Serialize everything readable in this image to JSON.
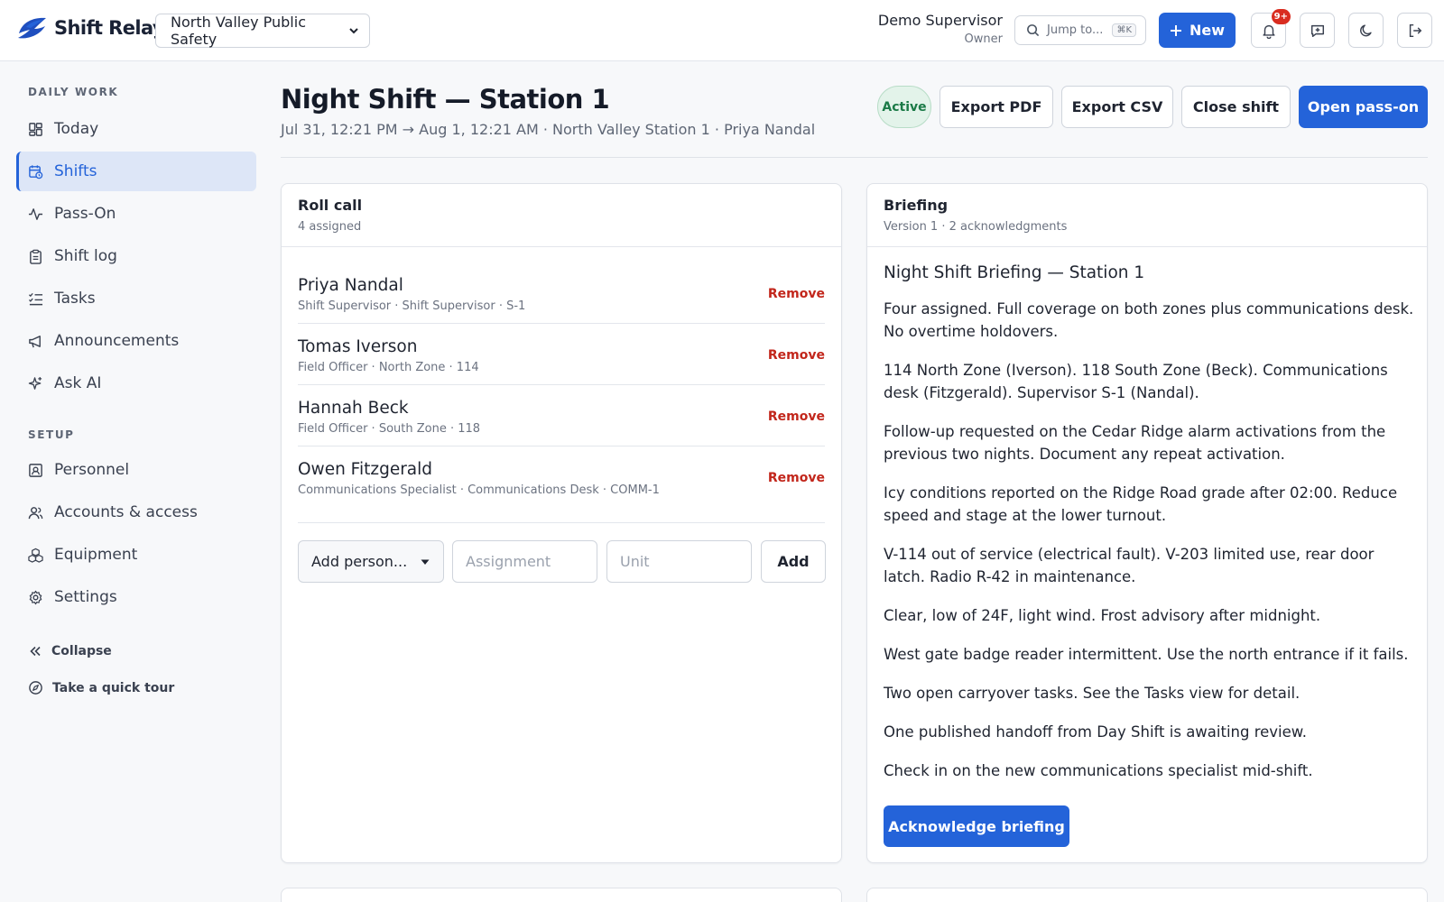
{
  "brand": {
    "name": "Shift Relay",
    "logo_icon": "shift-relay-logo-icon"
  },
  "org_select": {
    "value": "North Valley Public Safety"
  },
  "user": {
    "name": "Demo Supervisor",
    "role": "Owner"
  },
  "jump": {
    "placeholder": "Jump to...",
    "shortcut": "⌘K"
  },
  "new_button": {
    "label": "New"
  },
  "notifications": {
    "badge": "9+"
  },
  "sidebar": {
    "daily_heading": "DAILY WORK",
    "daily_items": [
      {
        "label": "Today",
        "icon": "dashboard-icon"
      },
      {
        "label": "Shifts",
        "icon": "calendar-clock-icon",
        "active": true
      },
      {
        "label": "Pass-On",
        "icon": "activity-icon"
      },
      {
        "label": "Shift log",
        "icon": "clipboard-icon"
      },
      {
        "label": "Tasks",
        "icon": "checklist-icon"
      },
      {
        "label": "Announcements",
        "icon": "megaphone-icon"
      },
      {
        "label": "Ask AI",
        "icon": "sparkles-icon"
      }
    ],
    "setup_heading": "SETUP",
    "setup_items": [
      {
        "label": "Personnel",
        "icon": "id-card-icon"
      },
      {
        "label": "Accounts & access",
        "icon": "users-icon"
      },
      {
        "label": "Equipment",
        "icon": "boxes-icon"
      },
      {
        "label": "Settings",
        "icon": "gear-icon"
      }
    ],
    "collapse_label": "Collapse",
    "tour_label": "Take a quick tour"
  },
  "shift": {
    "title": "Night Shift — Station 1",
    "subtitle": "Jul 31, 12:21 PM → Aug 1, 12:21 AM · North Valley Station 1 · Priya Nandal",
    "status": "Active",
    "actions": {
      "export_pdf": "Export PDF",
      "export_csv": "Export CSV",
      "close_shift": "Close shift",
      "open_pass_on": "Open pass-on"
    }
  },
  "roll_call": {
    "title": "Roll call",
    "subtitle": "4 assigned",
    "remove_label": "Remove",
    "people": [
      {
        "name": "Priya Nandal",
        "meta": "Shift Supervisor · Shift Supervisor · S-1"
      },
      {
        "name": "Tomas Iverson",
        "meta": "Field Officer · North Zone · 114"
      },
      {
        "name": "Hannah Beck",
        "meta": "Field Officer · South Zone · 118"
      },
      {
        "name": "Owen Fitzgerald",
        "meta": "Communications Specialist · Communications Desk · COMM-1"
      }
    ],
    "add_person": "Add person...",
    "assignment_placeholder": "Assignment",
    "unit_placeholder": "Unit",
    "add_label": "Add"
  },
  "briefing": {
    "title": "Briefing",
    "subtitle": "Version 1 · 2 acknowledgments",
    "heading": "Night Shift Briefing — Station 1",
    "paragraphs": [
      "Four assigned. Full coverage on both zones plus communications desk. No overtime holdovers.",
      "114 North Zone (Iverson). 118 South Zone (Beck). Communications desk (Fitzgerald). Supervisor S-1 (Nandal).",
      "Follow-up requested on the Cedar Ridge alarm activations from the previous two nights. Document any repeat activation.",
      "Icy conditions reported on the Ridge Road grade after 02:00. Reduce speed and stage at the lower turnout.",
      "V-114 out of service (electrical fault). V-203 limited use, rear door latch. Radio R-42 in maintenance.",
      "Clear, low of 24F, light wind. Frost advisory after midnight.",
      "West gate badge reader intermittent. Use the north entrance if it fails.",
      "Two open carryover tasks. See the Tasks view for detail.",
      "One published handoff from Day Shift is awaiting review.",
      "Check in on the new communications specialist mid-shift."
    ],
    "ack_label": "Acknowledge briefing"
  },
  "colors": {
    "accent": "#2463d9",
    "danger": "#c2261b",
    "success": "#1b7a47"
  }
}
